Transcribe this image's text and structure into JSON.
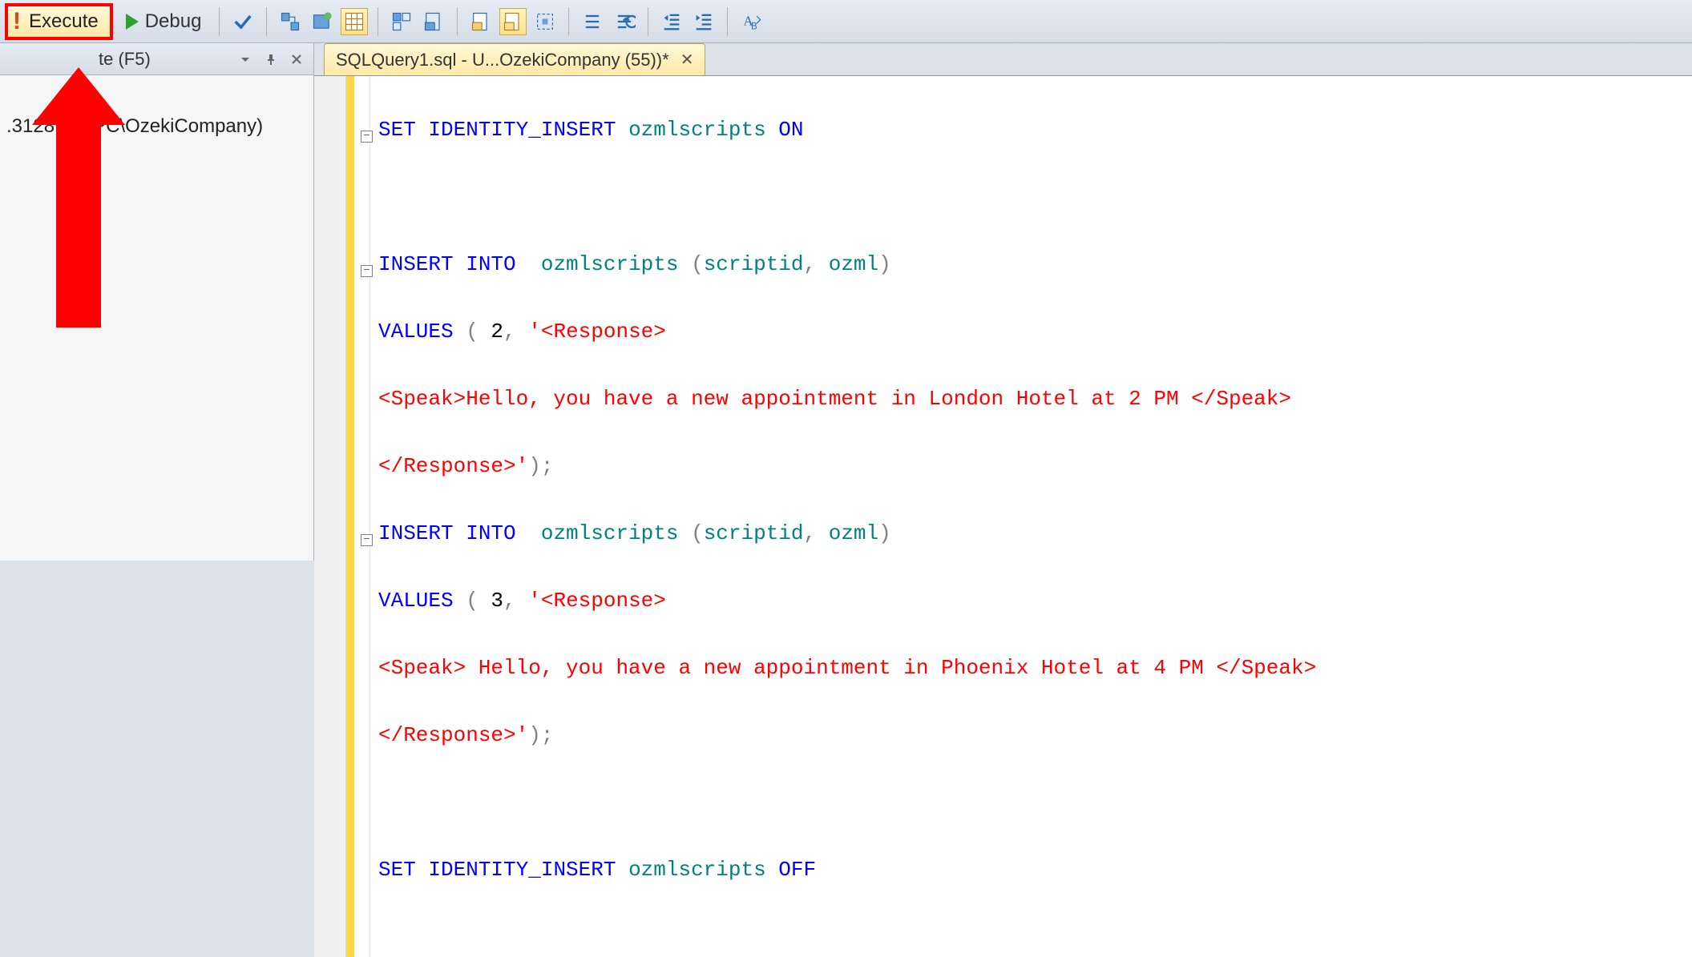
{
  "toolbar": {
    "execute_label": "Execute",
    "debug_label": "Debug"
  },
  "side_panel": {
    "header_suffix": "te (F5)",
    "tree_item": ".3128     ser-PC\\OzekiCompany)"
  },
  "tab": {
    "title": "SQLQuery1.sql - U...OzekiCompany (55))*"
  },
  "code": {
    "l1_a": "SET",
    "l1_b": " IDENTITY_INSERT ",
    "l1_c": "ozmlscripts ",
    "l1_d": "ON",
    "l3_a": "INSERT",
    "l3_b": " INTO",
    "l3_c": "  ozmlscripts ",
    "l3_d": "(",
    "l3_e": "scriptid",
    "l3_f": ",",
    "l3_g": " ozml",
    "l3_h": ")",
    "l4_a": "VALUES ",
    "l4_b": "(",
    "l4_c": " 2",
    "l4_d": ",",
    "l4_e": " '<Response>",
    "l5": "<Speak>Hello, you have a new appointment in London Hotel at 2 PM </Speak>",
    "l6_a": "</Response>'",
    "l6_b": ");",
    "l7_a": "INSERT",
    "l7_b": " INTO",
    "l7_c": "  ozmlscripts ",
    "l7_d": "(",
    "l7_e": "scriptid",
    "l7_f": ",",
    "l7_g": " ozml",
    "l7_h": ")",
    "l8_a": "VALUES ",
    "l8_b": "(",
    "l8_c": " 3",
    "l8_d": ",",
    "l8_e": " '<Response>",
    "l9": "<Speak> Hello, you have a new appointment in Phoenix Hotel at 4 PM </Speak>",
    "l10_a": "</Response>'",
    "l10_b": ");",
    "l12_a": "SET",
    "l12_b": " IDENTITY_INSERT ",
    "l12_c": "ozmlscripts ",
    "l12_d": "OFF"
  }
}
